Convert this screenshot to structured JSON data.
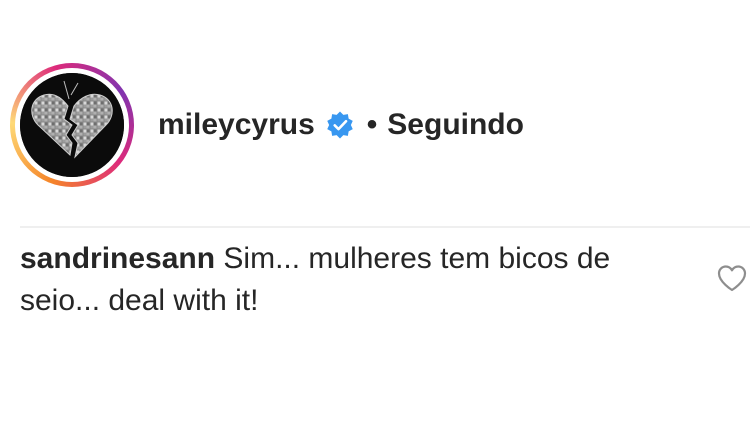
{
  "post_header": {
    "username": "mileycyrus",
    "verified_icon": "verified-badge-icon",
    "separator": "•",
    "follow_status": "Seguindo",
    "avatar_icon": "broken-disco-heart-avatar"
  },
  "comment": {
    "username": "sandrinesann",
    "text": "Sim... mulheres tem bicos de seio... deal with it!",
    "like_icon": "heart-outline-icon"
  },
  "colors": {
    "verified_blue": "#3897f0",
    "text": "#262626",
    "divider": "#efefef",
    "icon_gray": "#8e8e8e"
  }
}
